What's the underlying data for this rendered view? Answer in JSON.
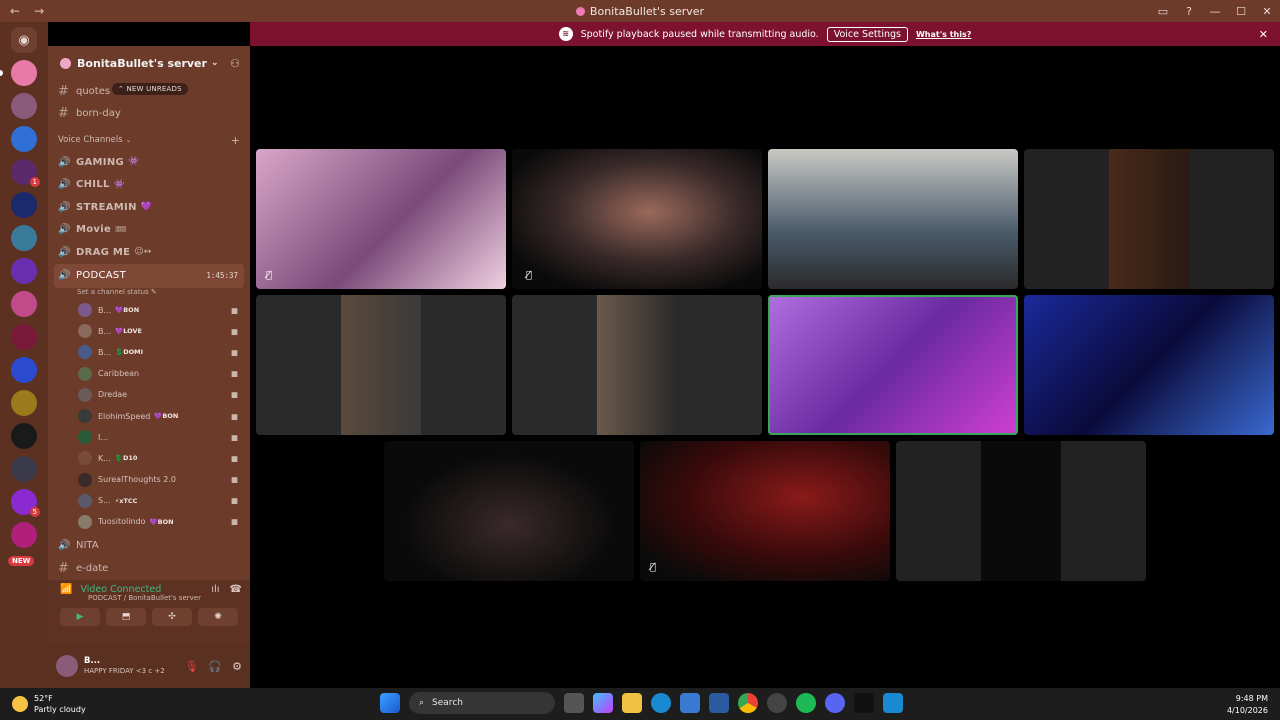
{
  "window": {
    "title": "BonitaBullet's server",
    "nav_back": "←",
    "nav_fwd": "→"
  },
  "banner": {
    "message": "Spotify playback paused while transmitting audio.",
    "voice_settings": "Voice Settings",
    "whats_this": "What's this?"
  },
  "sidebar": {
    "server_name": "BonitaBullet's server",
    "new_unreads": "NEW UNREADS",
    "text_channels": [
      "quotes",
      "born-day"
    ],
    "voice_category": "Voice Channels",
    "voice_channels": [
      {
        "name": "GAMING",
        "emoji": "👾"
      },
      {
        "name": "CHILL",
        "emoji": "👾"
      },
      {
        "name": "STREAMIN",
        "emoji": "💜"
      },
      {
        "name": "Movie",
        "emoji": "🎟"
      },
      {
        "name": "DRAG ME",
        "emoji": "😉↔"
      }
    ],
    "active_channel": {
      "name": "PODCAST",
      "timer": "1:45:37",
      "status": "Set a channel status"
    },
    "members": [
      {
        "name": "B...",
        "tag": "💜BON",
        "color": "#7a5a8a"
      },
      {
        "name": "B...",
        "tag": "💜LOVE",
        "color": "#8a6a5a"
      },
      {
        "name": "B...",
        "tag": "💲DOMI",
        "color": "#4a5a8a"
      },
      {
        "name": "Caribbean",
        "tag": "",
        "color": "#5a6a4a"
      },
      {
        "name": "Dredae",
        "tag": "",
        "color": "#6a5a5a"
      },
      {
        "name": "ElohimSpeed",
        "tag": "💜BON",
        "color": "#3a3a3a"
      },
      {
        "name": "I...",
        "tag": "",
        "color": "#2a5a3a"
      },
      {
        "name": "K...",
        "tag": "💲D10",
        "color": "#7a4a3a"
      },
      {
        "name": "SurealThoughts 2.0",
        "tag": "",
        "color": "#3a2a2a"
      },
      {
        "name": "S...",
        "tag": "⚡xTCC",
        "color": "#5a5a6a"
      },
      {
        "name": "Tuositolindo",
        "tag": "💜BON",
        "color": "#8a7a6a"
      }
    ],
    "after_channels": [
      "NITA",
      "e-date"
    ]
  },
  "rtc": {
    "connected": "Video Connected",
    "location": "PODCAST / BonitaBullet's server"
  },
  "user": {
    "name": "B...",
    "status": "HAPPY FRIDAY <3 c +2"
  },
  "taskbar": {
    "temp": "52°F",
    "weather": "Partly cloudy",
    "search": "Search",
    "time": "9:48 PM",
    "date": "4/10/2026"
  }
}
